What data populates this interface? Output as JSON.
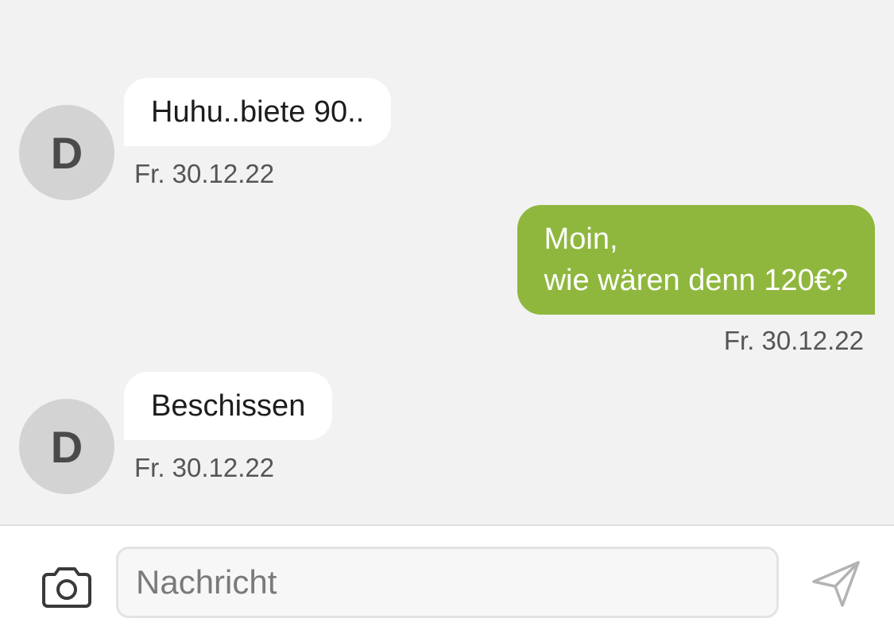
{
  "messages": [
    {
      "direction": "incoming",
      "avatar_letter": "D",
      "lines": [
        "Huhu..biete 90.."
      ],
      "timestamp": "Fr. 30.12.22"
    },
    {
      "direction": "outgoing",
      "lines": [
        "Moin,",
        "wie wären denn 120€?"
      ],
      "timestamp": "Fr. 30.12.22"
    },
    {
      "direction": "incoming",
      "avatar_letter": "D",
      "lines": [
        "Beschissen"
      ],
      "timestamp": "Fr. 30.12.22"
    }
  ],
  "composer": {
    "placeholder": "Nachricht",
    "value": "",
    "camera_icon": "camera-icon",
    "send_icon": "send-icon"
  },
  "colors": {
    "background": "#f2f2f2",
    "incoming_bubble": "#ffffff",
    "outgoing_bubble": "#8fb73e",
    "avatar": "#d3d3d3"
  }
}
